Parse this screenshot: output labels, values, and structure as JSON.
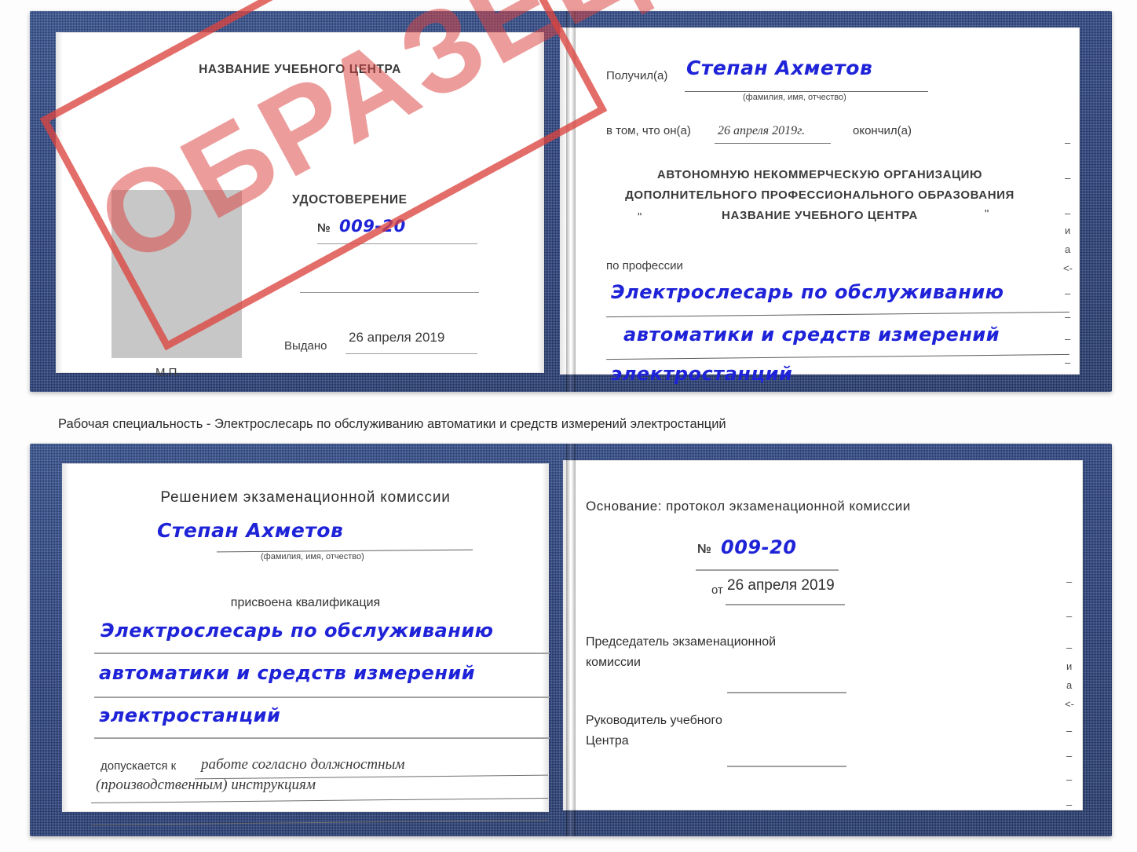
{
  "document": {
    "type": "certificate-scan",
    "watermark": "ОБРАЗЕЦ",
    "colors": {
      "cover_blue": "#2b4384",
      "stamp_red": "#db443f",
      "handwriting_blue": "#1f23d8",
      "photo_placeholder_gray": "#c7c7c7"
    }
  },
  "caption": {
    "text": "Рабочая специальность - Электрослесарь по обслуживанию автоматики и средств измерений электростанций"
  },
  "top_certificate": {
    "left_page": {
      "center_name": "НАЗВАНИЕ УЧЕБНОГО ЦЕНТРА",
      "doc_title": "УДОСТОВЕРЕНИЕ",
      "number_label": "№",
      "number_value": "009-20",
      "issued_label": "Выдано",
      "issued_value": "26 апреля 2019",
      "seal_label": "М.П."
    },
    "right_page": {
      "received_label": "Получил(а)",
      "received_value": "Степан Ахметов",
      "fio_hint": "(фамилия, имя, отчество)",
      "in_that_label": "в том, что он(а)",
      "in_that_value": "26 апреля 2019г.",
      "finished_label": "окончил(а)",
      "org_line1": "АВТОНОМНУЮ НЕКОММЕРЧЕСКУЮ ОРГАНИЗАЦИЮ",
      "org_line2": "ДОПОЛНИТЕЛЬНОГО ПРОФЕССИОНАЛЬНОГО ОБРАЗОВАНИЯ",
      "org_quote_open": "\"",
      "org_line3": "НАЗВАНИЕ УЧЕБНОГО ЦЕНТРА",
      "org_quote_close": "\"",
      "profession_label": "по профессии",
      "profession_line1": "Электрослесарь по обслуживанию",
      "profession_line2": "автоматики и средств измерений",
      "profession_line3": "электростанций",
      "edge_fragments": [
        "–",
        "–",
        "–",
        "и",
        "а",
        "<-",
        "–",
        "–",
        "–",
        "–"
      ]
    }
  },
  "bottom_certificate": {
    "left_page": {
      "heading": "Решением экзаменационной комиссии",
      "name_value": "Степан Ахметов",
      "fio_hint": "(фамилия, имя, отчество)",
      "qualification_label": "присвоена квалификация",
      "qualification_line1": "Электрослесарь по обслуживанию",
      "qualification_line2": "автоматики и средств измерений",
      "qualification_line3": "электростанций",
      "admitted_label": "допускается к",
      "admitted_value_line1": "работе согласно должностным",
      "admitted_value_line2": "(производственным) инструкциям"
    },
    "right_page": {
      "basis_label": "Основание: протокол экзаменационной комиссии",
      "number_label": "№",
      "number_value": "009-20",
      "date_label": "от",
      "date_value": "26 апреля 2019",
      "chair_line1": "Председатель экзаменационной",
      "chair_line2": "комиссии",
      "head_line1": "Руководитель учебного",
      "head_line2": "Центра",
      "edge_fragments": [
        "–",
        "–",
        "–",
        "и",
        "а",
        "<-",
        "–",
        "–",
        "–",
        "–"
      ]
    }
  }
}
